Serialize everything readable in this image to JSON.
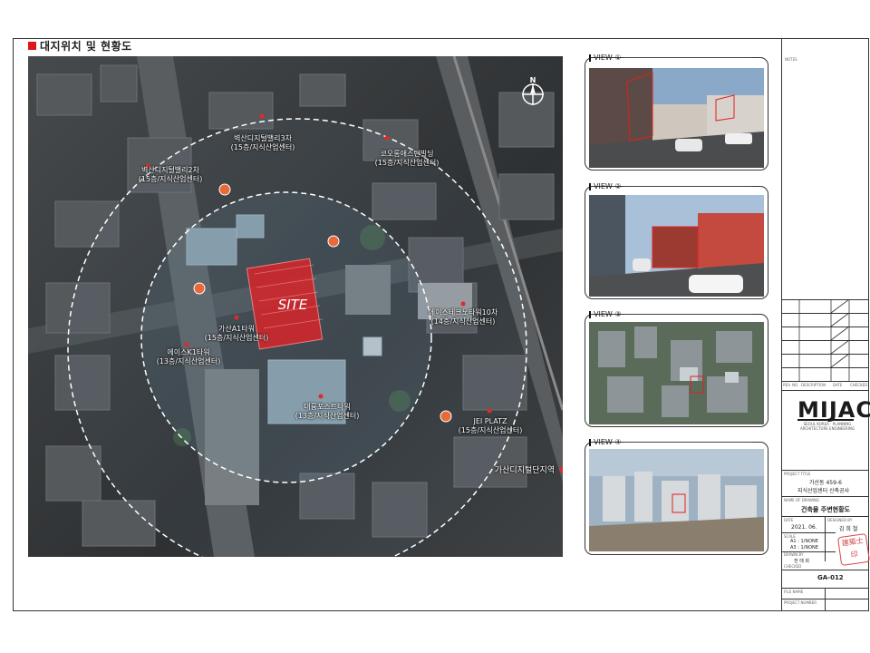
{
  "heading": "대지위치 및 현황도",
  "map": {
    "site": "SITE",
    "buildings": [
      {
        "name": "벽산디지털밸리3차",
        "info": "(15층/지식산업센터)"
      },
      {
        "name": "코오롱애스턴빌딩",
        "info": "(15층/지식산업센터)"
      },
      {
        "name": "벽산디지털밸리2차",
        "info": "(15층/지식산업센터)"
      },
      {
        "name": "가산A1타워",
        "info": "(15층/지식산업센터)"
      },
      {
        "name": "에이스테크노타워10차",
        "info": "(14층/지식산업센터)"
      },
      {
        "name": "에이스K1타워",
        "info": "(13층/지식산업센터)"
      },
      {
        "name": "대륭포스트타워",
        "info": "(13층/지식산업센터)"
      },
      {
        "name": "JEI PLATZ",
        "info": "(15층/지식산업센터)"
      }
    ],
    "district": "가산디지털단지역",
    "north": "N"
  },
  "views": [
    {
      "label": "VIEW ①"
    },
    {
      "label": "VIEW ②"
    },
    {
      "label": "VIEW ③"
    },
    {
      "label": "VIEW ④"
    }
  ],
  "title_block": {
    "notes": "NOTES",
    "rev_headers": [
      "REV. NO.",
      "DESCRIPTION",
      "DATE",
      "CHECKED"
    ],
    "logo": "MIJAC",
    "logo_sub": "SEOUL KOREA · PLANNING ARCHITECTURE ENGINEERING",
    "project_title_label": "PROJECT TITLE",
    "project_line1": "가산동 459-6",
    "project_line2": "지식산업센터 신축공사",
    "drawing_title_label": "NAME OF DRAWING",
    "drawing_title": "건축물 주변현황도",
    "date_label": "DATE",
    "date": "2021. 06.",
    "designed_by_label": "DESIGNED BY",
    "designed_by": "김 희 철",
    "scale_label": "SCALE",
    "scale_a1": "A1 : 1/NONE",
    "scale_a3": "A3 : 1/NONE",
    "drawn_by_label": "DRAWN BY",
    "drawn_by": "전 태 희",
    "checked_label": "CHECKED",
    "drawing_no": "GA-012",
    "file_name_label": "FILE NAME",
    "project_no_label": "PROJECT NUMBER",
    "stamp": "建築士印"
  }
}
